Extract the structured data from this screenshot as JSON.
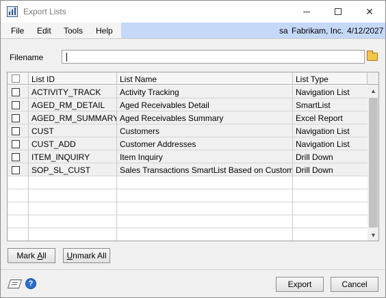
{
  "window": {
    "title": "Export Lists"
  },
  "menu": {
    "items": [
      "File",
      "Edit",
      "Tools",
      "Help"
    ]
  },
  "status": {
    "user": "sa",
    "company": "Fabrikam, Inc.",
    "date": "4/12/2027"
  },
  "filename": {
    "label": "Filename",
    "value": ""
  },
  "grid": {
    "columns": [
      "List ID",
      "List Name",
      "List Type"
    ],
    "rows": [
      {
        "id": "ACTIVITY_TRACK",
        "name": "Activity Tracking",
        "type": "Navigation List",
        "checked": false
      },
      {
        "id": "AGED_RM_DETAIL",
        "name": "Aged Receivables Detail",
        "type": "SmartList",
        "checked": false
      },
      {
        "id": "AGED_RM_SUMMARY",
        "name": "Aged Receivables Summary",
        "type": "Excel Report",
        "checked": false
      },
      {
        "id": "CUST",
        "name": "Customers",
        "type": "Navigation List",
        "checked": false
      },
      {
        "id": "CUST_ADD",
        "name": "Customer Addresses",
        "type": "Navigation List",
        "checked": false
      },
      {
        "id": "ITEM_INQUIRY",
        "name": "Item Inquiry",
        "type": "Drill Down",
        "checked": false
      },
      {
        "id": "SOP_SL_CUST",
        "name": "Sales Transactions SmartList Based on Customer",
        "type": "Drill Down",
        "checked": false
      }
    ]
  },
  "buttons": {
    "mark_all_pre": "Mark ",
    "mark_all_accel": "A",
    "mark_all_post": "ll",
    "unmark_all_pre": "",
    "unmark_all_accel": "U",
    "unmark_all_post": "nmark All",
    "export": "Export",
    "cancel": "Cancel"
  },
  "icons": {
    "app": "export-lists-app-icon",
    "folder": "folder-icon",
    "note": "note-icon",
    "help": "help-icon"
  },
  "colors": {
    "menu_status_bg": "#c5d8f7",
    "window_bg": "#f0f0f0",
    "help_blue": "#2a6fce"
  }
}
